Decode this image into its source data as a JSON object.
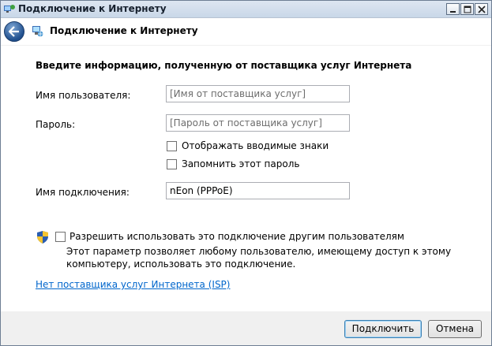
{
  "window": {
    "title": "Подключение к Интернету"
  },
  "header": {
    "title": "Подключение к Интернету"
  },
  "form": {
    "heading": "Введите информацию, полученную от поставщика услуг Интернета",
    "username_label": "Имя пользователя:",
    "username_placeholder": "[Имя от поставщика услуг]",
    "password_label": "Пароль:",
    "password_placeholder": "[Пароль от поставщика услуг]",
    "show_chars_label": "Отображать вводимые знаки",
    "remember_label": "Запомнить этот пароль",
    "connection_name_label": "Имя подключения:",
    "connection_name_value": "nEon (PPPoE)",
    "allow_others_label": "Разрешить использовать это подключение другим пользователям",
    "allow_others_desc": "Этот параметр позволяет любому пользователю, имеющему доступ к этому компьютеру, использовать это подключение.",
    "no_isp_link": "Нет поставщика услуг Интернета (ISP)"
  },
  "footer": {
    "connect_label": "Подключить",
    "cancel_label": "Отмена"
  }
}
